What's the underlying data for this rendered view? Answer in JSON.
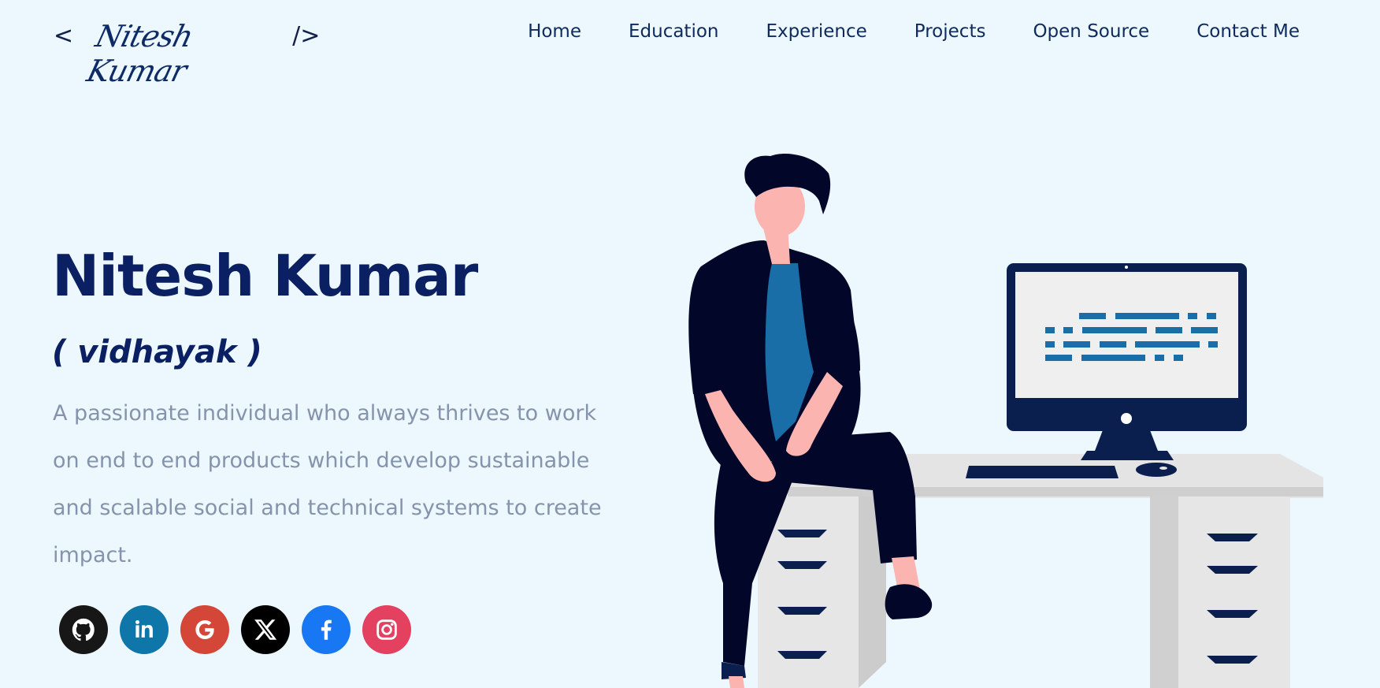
{
  "header": {
    "logo": {
      "open_bracket": "<",
      "signature": "Nitesh Kumar",
      "close_bracket": "/>"
    },
    "nav": [
      {
        "label": "Home"
      },
      {
        "label": "Education"
      },
      {
        "label": "Experience"
      },
      {
        "label": "Projects"
      },
      {
        "label": "Open Source"
      },
      {
        "label": "Contact Me"
      }
    ]
  },
  "hero": {
    "name": "Nitesh Kumar",
    "alias": "( vidhayak )",
    "bio": "A passionate individual who always thrives to work on end to end products which develop sustainable and scalable social and technical systems to create impact."
  },
  "social": [
    {
      "icon": "github-icon",
      "color": "#181717"
    },
    {
      "icon": "linkedin-icon",
      "color": "#0e76a8"
    },
    {
      "icon": "google-icon",
      "color": "#d44638"
    },
    {
      "icon": "x-icon",
      "color": "#000000"
    },
    {
      "icon": "facebook-icon",
      "color": "#1877f2"
    },
    {
      "icon": "instagram-icon",
      "color": "#e4405f"
    }
  ],
  "colors": {
    "background": "#ecf8fd",
    "primary": "#0b2063",
    "bio_text": "#8593ac"
  }
}
